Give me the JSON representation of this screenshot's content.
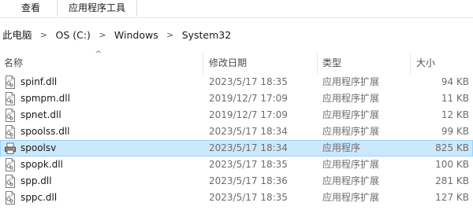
{
  "ribbon": {
    "view_label": "查看",
    "tools_label": "应用程序工具"
  },
  "address": {
    "segments": [
      "此电脑",
      "OS (C:)",
      "Windows",
      "System32"
    ],
    "separator": ">"
  },
  "columns": {
    "name": "名称",
    "date": "修改日期",
    "type": "类型",
    "size": "大小",
    "sort_indicator": "^"
  },
  "files": [
    {
      "name": "spinf.dll",
      "date": "2023/5/17 18:35",
      "type": "应用程序扩展",
      "size": "94 KB",
      "icon": "dll-file-icon"
    },
    {
      "name": "spmpm.dll",
      "date": "2019/12/7 17:09",
      "type": "应用程序扩展",
      "size": "11 KB",
      "icon": "dll-file-icon"
    },
    {
      "name": "spnet.dll",
      "date": "2019/12/7 17:09",
      "type": "应用程序扩展",
      "size": "12 KB",
      "icon": "dll-file-icon"
    },
    {
      "name": "spoolss.dll",
      "date": "2023/5/17 18:34",
      "type": "应用程序扩展",
      "size": "99 KB",
      "icon": "dll-file-icon"
    },
    {
      "name": "spoolsv",
      "date": "2023/5/17 18:34",
      "type": "应用程序",
      "size": "825 KB",
      "icon": "printer-icon",
      "selected": true
    },
    {
      "name": "spopk.dll",
      "date": "2023/5/17 18:35",
      "type": "应用程序扩展",
      "size": "100 KB",
      "icon": "dll-file-icon"
    },
    {
      "name": "spp.dll",
      "date": "2023/5/17 18:36",
      "type": "应用程序扩展",
      "size": "281 KB",
      "icon": "dll-file-icon"
    },
    {
      "name": "sppc.dll",
      "date": "2023/5/17 18:35",
      "type": "应用程序扩展",
      "size": "127 KB",
      "icon": "dll-file-icon"
    }
  ],
  "colors": {
    "selection_fill": "#cce8ff",
    "selection_border": "#99d1ff",
    "secondary_text": "#6d6d6d"
  }
}
